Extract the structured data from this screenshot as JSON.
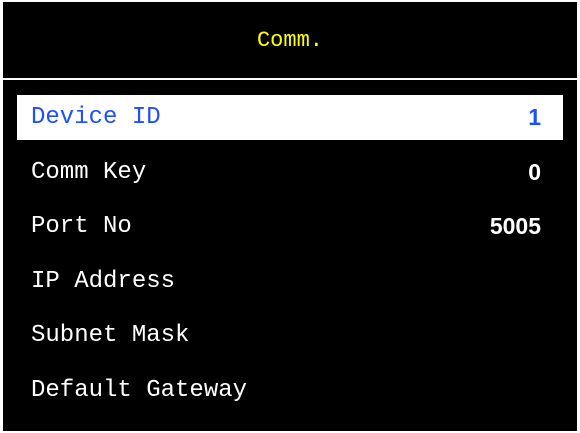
{
  "header": {
    "title": "Comm."
  },
  "colors": {
    "background": "#000000",
    "title": "#ffff00",
    "text": "#ffffff",
    "selected_background": "#ffffff",
    "selected_text": "#1f4fff"
  },
  "menu": {
    "selected_index": 0,
    "items": [
      {
        "label": "Device ID",
        "value": "1"
      },
      {
        "label": "Comm Key",
        "value": "0"
      },
      {
        "label": "Port No",
        "value": "5005"
      },
      {
        "label": "IP Address",
        "value": ""
      },
      {
        "label": "Subnet Mask",
        "value": ""
      },
      {
        "label": "Default Gateway",
        "value": ""
      }
    ]
  }
}
